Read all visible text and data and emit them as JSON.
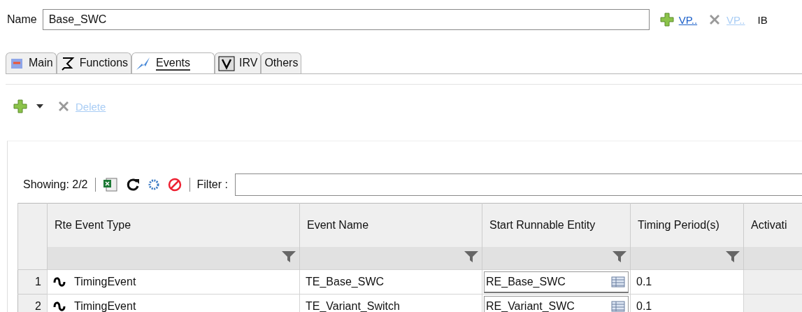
{
  "name_field": {
    "label": "Name",
    "value": "Base_SWC"
  },
  "header_actions": [
    {
      "kind": "add",
      "label": "VP..",
      "disabled": false
    },
    {
      "kind": "remove",
      "label": "VP..",
      "disabled": true
    }
  ],
  "header_extra": "IB",
  "tabs": [
    {
      "kind": "main",
      "label": "Main",
      "selected": false
    },
    {
      "kind": "functions",
      "label": "Functions",
      "selected": false
    },
    {
      "kind": "events",
      "label": "Events",
      "selected": true
    },
    {
      "kind": "irv",
      "label": "IRV",
      "selected": false
    },
    {
      "kind": "others",
      "label": "Others",
      "selected": false
    }
  ],
  "toolbar": [
    {
      "kind": "add"
    },
    {
      "kind": "menu"
    },
    {
      "kind": "delete",
      "label": "Delete",
      "disabled": true
    }
  ],
  "table_toolbar": {
    "showing": "Showing: 2/2",
    "filter_label": "Filter :"
  },
  "table": {
    "columns": [
      {
        "label": "Rte Event Type",
        "filter": true
      },
      {
        "label": "Event Name",
        "filter": true
      },
      {
        "label": "Start Runnable Entity",
        "filter": true
      },
      {
        "label": "Timing Period(s)",
        "filter": true
      },
      {
        "label": "Activati",
        "filter": false
      }
    ],
    "rows": [
      {
        "number": "1",
        "cells": [
          "TimingEvent",
          "TE_Base_SWC",
          "RE_Base_SWC",
          "0.1"
        ]
      },
      {
        "number": "2",
        "cells": [
          "TimingEvent",
          "TE_Variant_Switch",
          "RE_Variant_SWC",
          "0.1"
        ]
      }
    ]
  }
}
